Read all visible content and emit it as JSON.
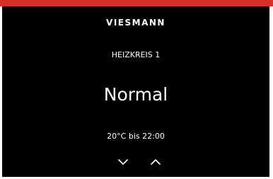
{
  "brand": {
    "logo_text": "VIESMANN",
    "accent_color": "#d8302d"
  },
  "screen": {
    "heading": "HEIZKREIS 1",
    "mode": "Normal",
    "schedule": "20°C bis 22:00"
  },
  "controls": {
    "down_icon": "chevron-down-icon",
    "up_icon": "chevron-up-icon"
  }
}
